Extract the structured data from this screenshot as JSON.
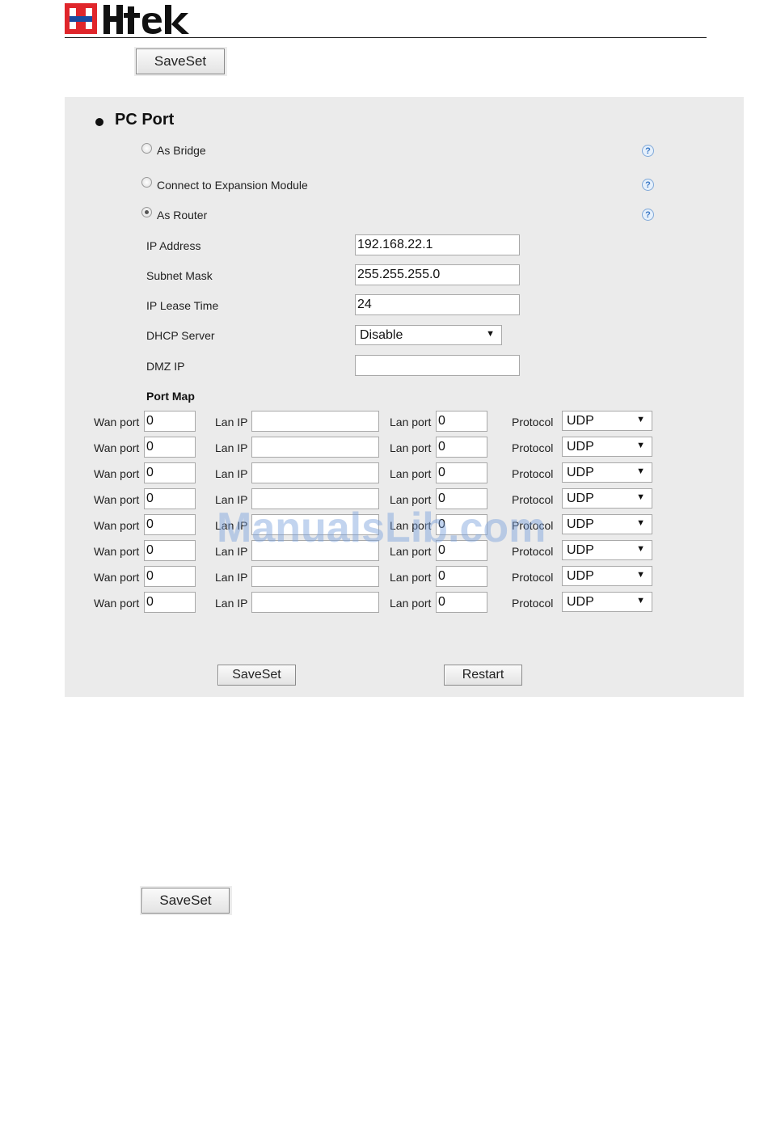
{
  "header": {
    "brand": "Htek"
  },
  "top_saveset_label": "SaveSet",
  "section": {
    "title": "PC Port",
    "options": [
      {
        "label": "As Bridge",
        "selected": false
      },
      {
        "label": "Connect to Expansion Module",
        "selected": false
      },
      {
        "label": "As Router",
        "selected": true
      }
    ],
    "help_glyph": "?",
    "router": {
      "ip_address_label": "IP Address",
      "ip_address_value": "192.168.22.1",
      "subnet_mask_label": "Subnet Mask",
      "subnet_mask_value": "255.255.255.0",
      "ip_lease_time_label": "IP Lease Time",
      "ip_lease_time_value": "24",
      "dhcp_server_label": "DHCP Server",
      "dhcp_server_value": "Disable",
      "dmz_ip_label": "DMZ IP",
      "dmz_ip_value": ""
    },
    "port_map": {
      "title": "Port Map",
      "wan_port_label": "Wan port",
      "lan_ip_label": "Lan IP",
      "lan_port_label": "Lan port",
      "protocol_label": "Protocol",
      "rows": [
        {
          "wan_port": "0",
          "lan_ip": "",
          "lan_port": "0",
          "protocol": "UDP"
        },
        {
          "wan_port": "0",
          "lan_ip": "",
          "lan_port": "0",
          "protocol": "UDP"
        },
        {
          "wan_port": "0",
          "lan_ip": "",
          "lan_port": "0",
          "protocol": "UDP"
        },
        {
          "wan_port": "0",
          "lan_ip": "",
          "lan_port": "0",
          "protocol": "UDP"
        },
        {
          "wan_port": "0",
          "lan_ip": "",
          "lan_port": "0",
          "protocol": "UDP"
        },
        {
          "wan_port": "0",
          "lan_ip": "",
          "lan_port": "0",
          "protocol": "UDP"
        },
        {
          "wan_port": "0",
          "lan_ip": "",
          "lan_port": "0",
          "protocol": "UDP"
        },
        {
          "wan_port": "0",
          "lan_ip": "",
          "lan_port": "0",
          "protocol": "UDP"
        }
      ]
    },
    "saveset_label": "SaveSet",
    "restart_label": "Restart"
  },
  "bottom_saveset_label": "SaveSet",
  "watermark": "ManualsLib.com",
  "colors": {
    "panel_bg": "#ebebeb",
    "logo_red": "#e0262b",
    "logo_blue": "#1a4aa0",
    "help_blue": "#3b78c4"
  }
}
